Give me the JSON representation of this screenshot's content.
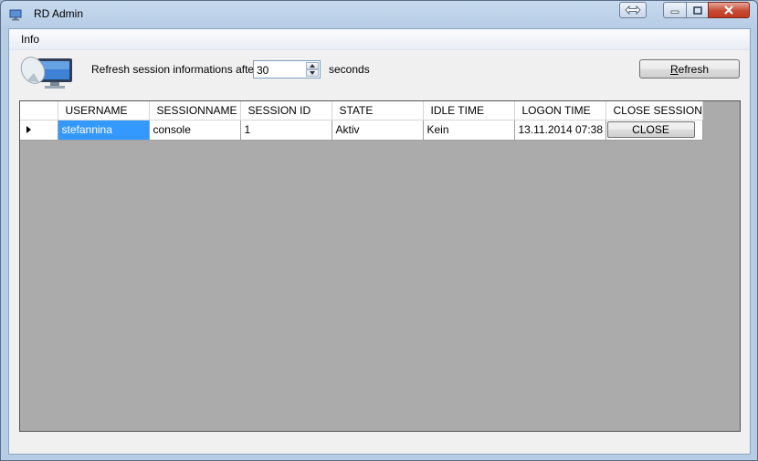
{
  "window": {
    "title": "RD Admin"
  },
  "menu": {
    "items": [
      {
        "label": "Info"
      }
    ]
  },
  "toolbar": {
    "refresh_label": "Refresh session informations after",
    "interval_value": "30",
    "interval_unit": "seconds",
    "refresh_button": "Refresh",
    "refresh_button_mnemonic": "R"
  },
  "grid": {
    "columns": [
      "USERNAME",
      "SESSIONNAME",
      "SESSION ID",
      "STATE",
      "IDLE TIME",
      "LOGON TIME",
      "CLOSE SESSION"
    ],
    "rows": [
      {
        "username": "stefannina",
        "sessionname": "console",
        "session_id": "1",
        "state": "Aktiv",
        "idle_time": "Kein",
        "logon_time": "13.11.2014 07:38",
        "close_label": "CLOSE"
      }
    ]
  },
  "colors": {
    "selection": "#3399ff",
    "grid_background": "#ababab",
    "close_red": "#c74a34"
  }
}
